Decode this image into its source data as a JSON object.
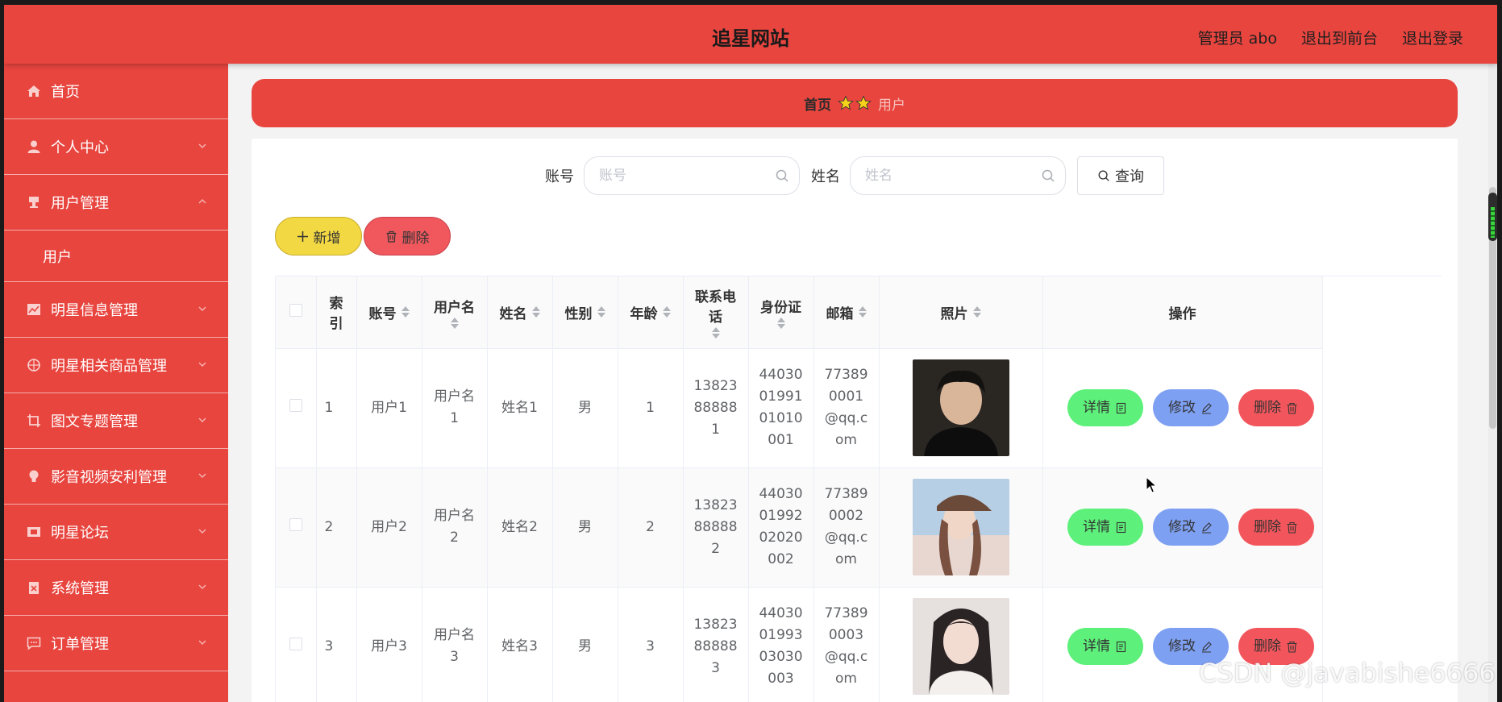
{
  "header": {
    "title": "追星网站",
    "admin_label": "管理员 abo",
    "exit_front": "退出到前台",
    "logout": "退出登录"
  },
  "sidebar": {
    "items": [
      {
        "label": "首页",
        "icon": "home-icon"
      },
      {
        "label": "个人中心",
        "icon": "user-icon"
      },
      {
        "label": "用户管理",
        "icon": "podium-icon"
      },
      {
        "label": "明星信息管理",
        "icon": "chart-icon"
      },
      {
        "label": "明星相关商品管理",
        "icon": "compass-icon"
      },
      {
        "label": "图文专题管理",
        "icon": "crop-icon"
      },
      {
        "label": "影音视频安利管理",
        "icon": "bulb-icon"
      },
      {
        "label": "明星论坛",
        "icon": "film-icon"
      },
      {
        "label": "系统管理",
        "icon": "clipboard-icon"
      },
      {
        "label": "订单管理",
        "icon": "chat-icon"
      }
    ],
    "submenu": {
      "label": "用户"
    }
  },
  "breadcrumb": {
    "home": "首页",
    "current": "用户"
  },
  "search": {
    "account_label": "账号",
    "account_placeholder": "账号",
    "name_label": "姓名",
    "name_placeholder": "姓名",
    "query_button": "查询"
  },
  "actions": {
    "add": "新增",
    "delete": "删除"
  },
  "table": {
    "headers": {
      "index": "索引",
      "account": "账号",
      "username": "用户名",
      "name": "姓名",
      "gender": "性别",
      "age": "年龄",
      "phone": "联系电话",
      "id_card": "身份证",
      "email": "邮箱",
      "photo": "照片",
      "ops": "操作"
    },
    "rows": [
      {
        "index": "1",
        "account": "用户1",
        "username": "用户名1",
        "name": "姓名1",
        "gender": "男",
        "age": "1",
        "phone": "13823888881",
        "id_card": "440300199101010001",
        "email": "773890001@qq.com"
      },
      {
        "index": "2",
        "account": "用户2",
        "username": "用户名2",
        "name": "姓名2",
        "gender": "男",
        "age": "2",
        "phone": "13823888882",
        "id_card": "440300199202020002",
        "email": "773890002@qq.com"
      },
      {
        "index": "3",
        "account": "用户3",
        "username": "用户名3",
        "name": "姓名3",
        "gender": "男",
        "age": "3",
        "phone": "13823888883",
        "id_card": "440300199303030003",
        "email": "773890003@qq.com"
      }
    ],
    "row_buttons": {
      "detail": "详情",
      "edit": "修改",
      "delete": "删除"
    }
  },
  "watermark": "CSDN @javabishe6666",
  "colors": {
    "primary_red": "#e8453f",
    "add_yellow": "#f2d843",
    "delete_red": "#f0585e",
    "detail_green": "#5df07a",
    "edit_blue": "#7ea0f2"
  }
}
